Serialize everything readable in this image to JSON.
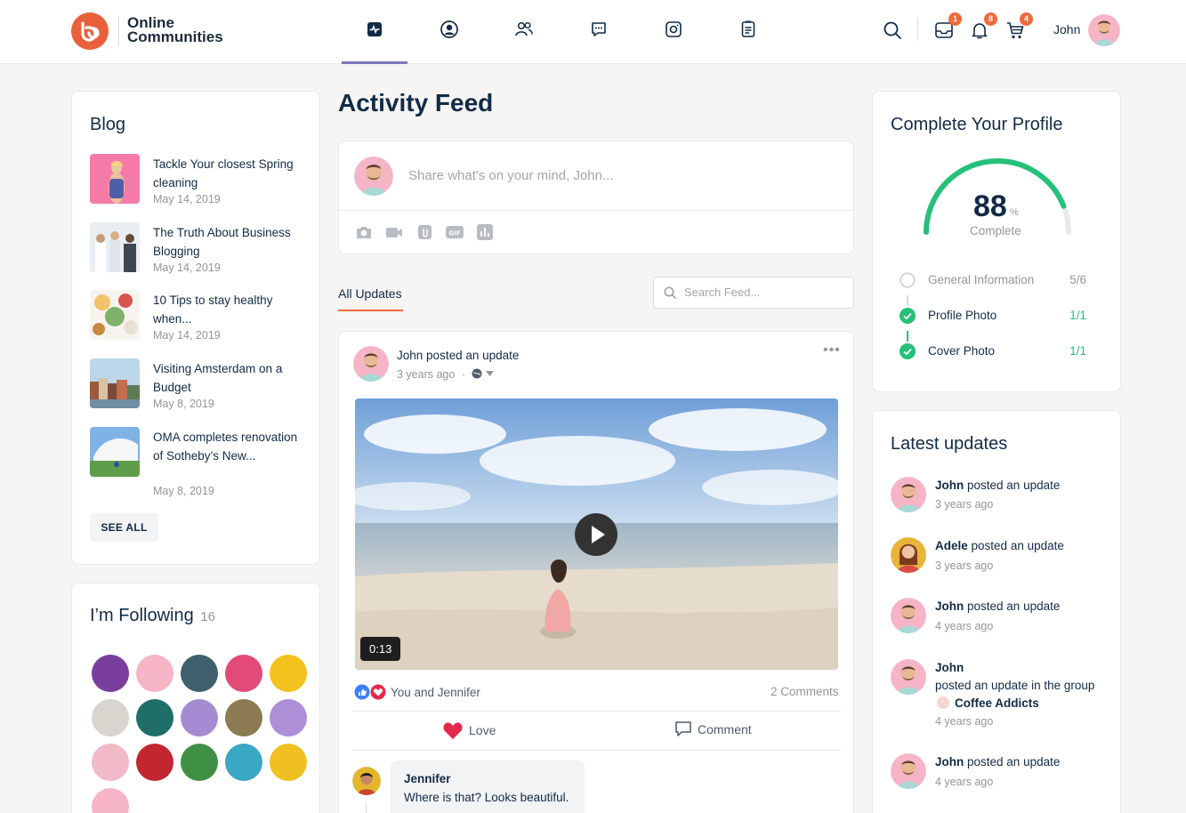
{
  "header": {
    "brand": "Online Communities",
    "brand_line1": "Online",
    "brand_line2": "Communities",
    "user_name": "John",
    "badges": {
      "messages": "1",
      "notifications": "8",
      "cart": "4"
    }
  },
  "nav": [
    "activity-icon",
    "profile-icon",
    "friends-icon",
    "messages-icon",
    "photos-icon",
    "documents-icon"
  ],
  "blog": {
    "title": "Blog",
    "see_all": "SEE ALL",
    "posts": [
      {
        "title": "Tackle Your closest Spring cleaning",
        "date": "May 14, 2019"
      },
      {
        "title": "The Truth About Business Blogging",
        "date": "May 14, 2019"
      },
      {
        "title": "10 Tips to stay healthy when...",
        "date": "May 14, 2019"
      },
      {
        "title": "Visiting Amsterdam on a Budget",
        "date": "May 8, 2019"
      },
      {
        "title": "OMA completes renovation of Sotheby’s New...",
        "date": "May 8, 2019"
      }
    ]
  },
  "following": {
    "title": "I’m Following",
    "count": "16"
  },
  "feed": {
    "title": "Activity Feed",
    "composer_placeholder": "Share what's on your mind, John...",
    "tab_all": "All Updates",
    "search_placeholder": "Search Feed...",
    "post": {
      "author": "John",
      "action": "posted an update",
      "time": "3 years ago",
      "duration": "0:13",
      "reactions": "You and Jennifer",
      "comments": "2 Comments",
      "love_label": "Love",
      "comment_label": "Comment",
      "comment": {
        "author": "Jennifer",
        "text": "Where is that? Looks beautiful."
      }
    }
  },
  "profile": {
    "title": "Complete Your Profile",
    "percent": 88,
    "percent_text": "88",
    "percent_sign": "%",
    "complete_label": "Complete",
    "steps": [
      {
        "label": "General Information",
        "count": "5/6"
      },
      {
        "label": "Profile Photo",
        "count": "1/1"
      },
      {
        "label": "Cover Photo",
        "count": "1/1"
      }
    ]
  },
  "latest": {
    "title": "Latest updates",
    "items": [
      {
        "name": "John",
        "text": "posted an update",
        "time": "3 years ago"
      },
      {
        "name": "Adele",
        "text": "posted an update",
        "time": "3 years ago"
      },
      {
        "name": "John",
        "text": "posted an update",
        "time": "4 years ago"
      },
      {
        "name": "John",
        "text": "posted an update in the group",
        "group": "Coffee Addicts",
        "time": "4 years ago"
      },
      {
        "name": "John",
        "text": "posted an update",
        "time": "4 years ago"
      }
    ]
  },
  "colors": {
    "accent": "#ef6a3b",
    "brand": "#e8613a",
    "success": "#25c07a",
    "nav_active": "#7b79b7",
    "love": "#e5294c",
    "like": "#3b82f6"
  }
}
